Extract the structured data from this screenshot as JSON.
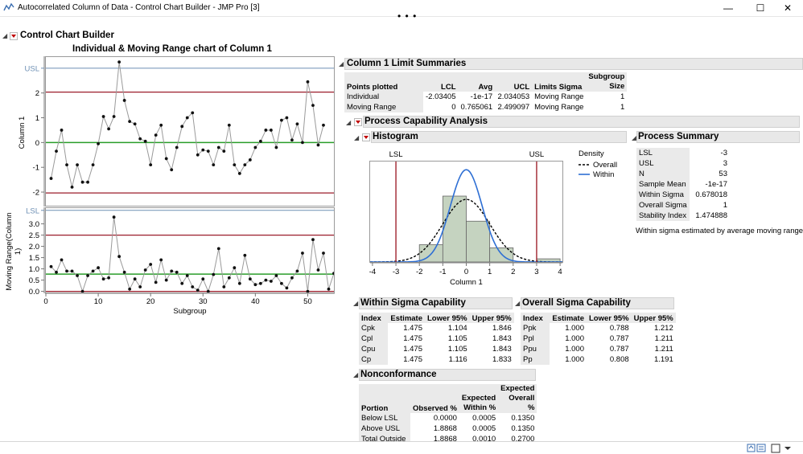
{
  "window": {
    "title": "Autocorrelated Column of Data - Control Chart Builder - JMP Pro [3]",
    "minimize": "—",
    "maximize": "☐",
    "close": "✕",
    "more": "• • •"
  },
  "builder": {
    "title": "Control Chart Builder",
    "chart_title": "Individual & Moving Range chart of Column 1"
  },
  "limits": {
    "title": "Column 1 Limit Summaries",
    "headers": [
      "Points plotted",
      "LCL",
      "Avg",
      "UCL",
      "Limits Sigma",
      "Subgroup Size"
    ],
    "rows": [
      [
        "Individual",
        "-2.03405",
        "-1e-17",
        "2.034053",
        "Moving Range",
        "1"
      ],
      [
        "Moving Range",
        "0",
        "0.765061",
        "2.499097",
        "Moving Range",
        "1"
      ]
    ]
  },
  "capability": {
    "title": "Process Capability Analysis",
    "histogram_title": "Histogram",
    "summary_title": "Process Summary",
    "summary_rows": [
      [
        "LSL",
        "-3"
      ],
      [
        "USL",
        "3"
      ],
      [
        "N",
        "53"
      ],
      [
        "Sample Mean",
        "-1e-17"
      ],
      [
        "Within Sigma",
        "0.678018"
      ],
      [
        "Overall Sigma",
        "1"
      ],
      [
        "Stability Index",
        "1.474888"
      ]
    ],
    "note": "Within sigma estimated by average moving range.",
    "within": {
      "title": "Within Sigma Capability",
      "headers": [
        "Index",
        "Estimate",
        "Lower 95%",
        "Upper 95%"
      ],
      "rows": [
        [
          "Cpk",
          "1.475",
          "1.104",
          "1.846"
        ],
        [
          "Cpl",
          "1.475",
          "1.105",
          "1.843"
        ],
        [
          "Cpu",
          "1.475",
          "1.105",
          "1.843"
        ],
        [
          "Cp",
          "1.475",
          "1.116",
          "1.833"
        ]
      ]
    },
    "overall": {
      "title": "Overall Sigma Capability",
      "headers": [
        "Index",
        "Estimate",
        "Lower 95%",
        "Upper 95%"
      ],
      "rows": [
        [
          "Ppk",
          "1.000",
          "0.788",
          "1.212"
        ],
        [
          "Ppl",
          "1.000",
          "0.787",
          "1.211"
        ],
        [
          "Ppu",
          "1.000",
          "0.787",
          "1.211"
        ],
        [
          "Pp",
          "1.000",
          "0.808",
          "1.191"
        ]
      ]
    },
    "nonconf": {
      "title": "Nonconformance",
      "headers": [
        "Portion",
        "Observed %",
        "Expected Within %",
        "Expected Overall %"
      ],
      "rows": [
        [
          "Below LSL",
          "0.0000",
          "0.0005",
          "0.1350"
        ],
        [
          "Above USL",
          "1.8868",
          "0.0005",
          "0.1350"
        ],
        [
          "Total Outside",
          "1.8868",
          "0.0010",
          "0.2700"
        ]
      ]
    }
  },
  "chart_data": [
    {
      "type": "line",
      "name": "individual-chart",
      "ylabel": "Column 1",
      "yticks": [
        "-2",
        "-1",
        "0",
        "1",
        "2"
      ],
      "ytick_values": [
        -2,
        -1,
        0,
        1,
        2
      ],
      "ylim": [
        -2.55,
        3.45
      ],
      "xlim": [
        0,
        55
      ],
      "limit_lines": {
        "USL": 3,
        "UCL": 2.034053,
        "Avg": 0,
        "LCL": -2.03405
      },
      "usl_label": "USL",
      "colors": {
        "usl": "#6d8fb4",
        "limit": "#9b1c2a",
        "avg": "#2a9d2a",
        "line": "#9a9a9a",
        "point": "#111111"
      },
      "values": [
        -1.45,
        -0.35,
        0.5,
        -0.9,
        -1.8,
        -0.9,
        -1.6,
        -1.6,
        -0.9,
        -0.05,
        1.05,
        0.55,
        1.05,
        3.25,
        1.7,
        0.85,
        0.75,
        0.15,
        0.05,
        -0.9,
        0.3,
        0.7,
        -0.65,
        -1.1,
        -0.2,
        0.65,
        1.0,
        1.2,
        -0.5,
        -0.3,
        -0.35,
        -0.9,
        -0.2,
        -0.35,
        0.7,
        -0.9,
        -1.25,
        -0.9,
        -0.7,
        -0.2,
        0.05,
        0.5,
        0.5,
        -0.2,
        0.9,
        1.0,
        0.1,
        0.75,
        0.0,
        2.45,
        1.5,
        -0.1,
        0.7
      ]
    },
    {
      "type": "line",
      "name": "moving-range-chart",
      "ylabel": "Moving Range(Column 1)",
      "xlabel": "Subgroup",
      "yticks": [
        "0.0",
        "0.5",
        "1.0",
        "1.5",
        "2.0",
        "2.5",
        "3.0"
      ],
      "ytick_values": [
        0,
        0.5,
        1,
        1.5,
        2,
        2.5,
        3
      ],
      "xticks": [
        "0",
        "10",
        "20",
        "30",
        "40",
        "50"
      ],
      "xtick_values": [
        0,
        10,
        20,
        30,
        40,
        50
      ],
      "ylim": [
        -0.05,
        3.7
      ],
      "xlim": [
        0,
        55
      ],
      "limit_lines": {
        "LSL": 3.6,
        "UCL": 2.499097,
        "Avg": 0.765061,
        "LCL": 0
      },
      "lsl_label": "LSL",
      "colors": {
        "usl": "#6d8fb4",
        "limit": "#9b1c2a",
        "avg": "#2a9d2a",
        "line": "#9a9a9a",
        "point": "#111111"
      },
      "values": [
        1.1,
        0.85,
        1.4,
        0.9,
        0.9,
        0.7,
        0.0,
        0.7,
        0.9,
        1.05,
        0.55,
        0.6,
        3.3,
        1.55,
        0.85,
        0.1,
        0.55,
        0.2,
        0.95,
        1.2,
        0.4,
        1.4,
        0.5,
        0.9,
        0.85,
        0.35,
        0.7,
        0.2,
        0.05,
        0.55,
        0.0,
        0.75,
        1.9,
        0.2,
        0.6,
        1.05,
        0.35,
        1.6,
        0.55,
        0.3,
        0.35,
        0.5,
        0.45,
        0.7,
        0.35,
        0.15,
        0.6,
        0.9,
        1.7,
        0.0,
        2.3,
        0.95,
        1.7,
        0.1,
        0.8
      ]
    },
    {
      "type": "bar",
      "name": "histogram",
      "xlabel": "Column 1",
      "xticks": [
        "-4",
        "-3",
        "-2",
        "-1",
        "0",
        "1",
        "2",
        "3",
        "4"
      ],
      "xtick_values": [
        -4,
        -3,
        -2,
        -1,
        0,
        1,
        2,
        3,
        4
      ],
      "xlim": [
        -4.1,
        4.1
      ],
      "bins": [
        {
          "from": -2,
          "to": -1,
          "density": 0.11
        },
        {
          "from": -1,
          "to": 0,
          "density": 0.42
        },
        {
          "from": 0,
          "to": 1,
          "density": 0.26
        },
        {
          "from": 1,
          "to": 2,
          "density": 0.09
        },
        {
          "from": 3,
          "to": 4,
          "density": 0.02
        }
      ],
      "spec_limits": {
        "LSL": -3,
        "USL": 3
      },
      "spec_labels": [
        "LSL",
        "USL"
      ],
      "legend_title": "Density",
      "legend": [
        "Overall",
        "Within"
      ],
      "overall_sigma": 1,
      "within_sigma": 0.678018,
      "mean": 0,
      "colors": {
        "bar": "#c5d3c0",
        "bar_edge": "#666666",
        "within": "#2e6fd4",
        "overall": "#000000",
        "spec": "#a0242f"
      }
    }
  ]
}
